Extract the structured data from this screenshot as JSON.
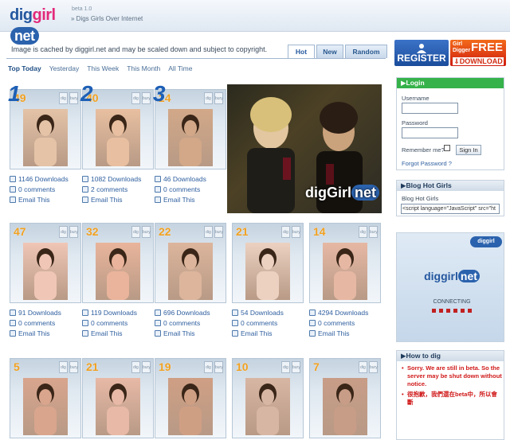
{
  "header": {
    "logo": {
      "dig": "dig",
      "girl": "girl",
      "net": "net"
    },
    "beta": "beta 1.0",
    "tagline": "Digs Girls Over Internet"
  },
  "notice": "Image is cached by diggirl.net and may be scaled down and subject to copyright.",
  "sort_tabs": [
    "Hot",
    "New",
    "Random"
  ],
  "periods": [
    "Top Today",
    "Yesterday",
    "This Week",
    "This Month",
    "All Time"
  ],
  "mini_labels": [
    "dig",
    "bury"
  ],
  "cards": [
    {
      "rank": "1",
      "count": "49",
      "downloads": "1146 Downloads",
      "comments": "0 comments",
      "email": "Email This"
    },
    {
      "rank": "2",
      "count": "40",
      "downloads": "1082 Downloads",
      "comments": "2 comments",
      "email": "Email This"
    },
    {
      "rank": "3",
      "count": "24",
      "downloads": "46 Downloads",
      "comments": "0 comments",
      "email": "Email This"
    },
    {
      "rank": "",
      "count": "47",
      "downloads": "91 Downloads",
      "comments": "0 comments",
      "email": "Email This"
    },
    {
      "rank": "",
      "count": "32",
      "downloads": "119 Downloads",
      "comments": "0 comments",
      "email": "Email This"
    },
    {
      "rank": "",
      "count": "22",
      "downloads": "696 Downloads",
      "comments": "0 comments",
      "email": "Email This"
    },
    {
      "rank": "",
      "count": "21",
      "downloads": "54 Downloads",
      "comments": "0 comments",
      "email": "Email This"
    },
    {
      "rank": "",
      "count": "14",
      "downloads": "4294 Downloads",
      "comments": "0 comments",
      "email": "Email This"
    },
    {
      "rank": "",
      "count": "5",
      "downloads": "",
      "comments": "",
      "email": ""
    },
    {
      "rank": "",
      "count": "21",
      "downloads": "",
      "comments": "",
      "email": ""
    },
    {
      "rank": "",
      "count": "19",
      "downloads": "",
      "comments": "",
      "email": ""
    },
    {
      "rank": "",
      "count": "10",
      "downloads": "",
      "comments": "",
      "email": ""
    },
    {
      "rank": "",
      "count": "7",
      "downloads": "",
      "comments": "",
      "email": ""
    }
  ],
  "banner": {
    "brand_dig": "digGirl",
    "brand_net": "net"
  },
  "sidebar": {
    "register": "REGISTER",
    "download": {
      "line1": "Girl",
      "line2": "Digger",
      "free": "FREE",
      "label": "DOWNLOAD"
    },
    "login": {
      "title": "Login",
      "username": "Username",
      "password": "Password",
      "remember": "Remember me?",
      "signin": "Sign In",
      "forgot": "Forgot Password ?"
    },
    "blog": {
      "title": "Blog Hot Girls",
      "label": "Blog Hot Girls",
      "code": "<script language=\"JavaScript\" src=\"ht"
    },
    "widget": {
      "brand": "diggirl",
      "net": "net",
      "status": "CONNECTING"
    },
    "how": {
      "title": "How to dig",
      "items": [
        "Sorry. We are still in beta. So the server may be shut down without notice.",
        "很抱歉，我們還在beta中，所以會斷"
      ]
    }
  },
  "colors": {
    "accent": "#24579f",
    "count": "#f0a020",
    "login_header": "#36b24a",
    "warn": "#d01818"
  }
}
